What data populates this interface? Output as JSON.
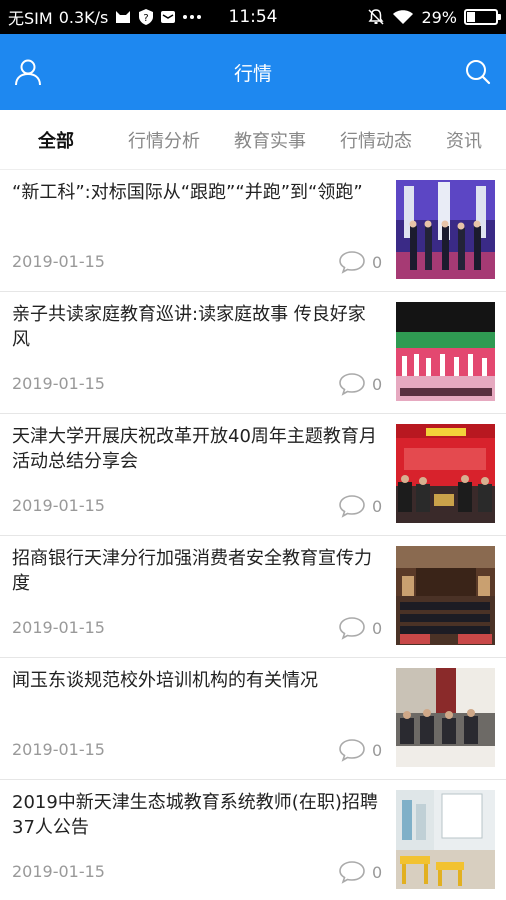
{
  "status_bar": {
    "carrier": "无SIM",
    "speed": "0.3K/s",
    "time": "11:54",
    "battery": "29%",
    "battery_level": 0.29
  },
  "header": {
    "title": "行情",
    "user_icon": "user-icon",
    "search_icon": "search-icon",
    "color": "#1e88f0"
  },
  "tabs": [
    {
      "label": "全部",
      "active": true
    },
    {
      "label": "行情分析",
      "active": false
    },
    {
      "label": "教育实事",
      "active": false
    },
    {
      "label": "行情动态",
      "active": false
    },
    {
      "label": "资讯",
      "active": false
    }
  ],
  "news": [
    {
      "title": "“新工科”:对标国际从“跟跑”“并跑”到“领跑”",
      "date": "2019-01-15",
      "comments": "0"
    },
    {
      "title": "亲子共读家庭教育巡讲:读家庭故事 传良好家风",
      "date": "2019-01-15",
      "comments": "0"
    },
    {
      "title": "天津大学开展庆祝改革开放40周年主题教育月活动总结分享会",
      "date": "2019-01-15",
      "comments": "0"
    },
    {
      "title": "招商银行天津分行加强消费者安全教育宣传力度",
      "date": "2019-01-15",
      "comments": "0"
    },
    {
      "title": "闻玉东谈规范校外培训机构的有关情况",
      "date": "2019-01-15",
      "comments": "0"
    },
    {
      "title": "2019中新天津生态城教育系统教师(在职)招聘37人公告",
      "date": "2019-01-15",
      "comments": "0"
    }
  ]
}
